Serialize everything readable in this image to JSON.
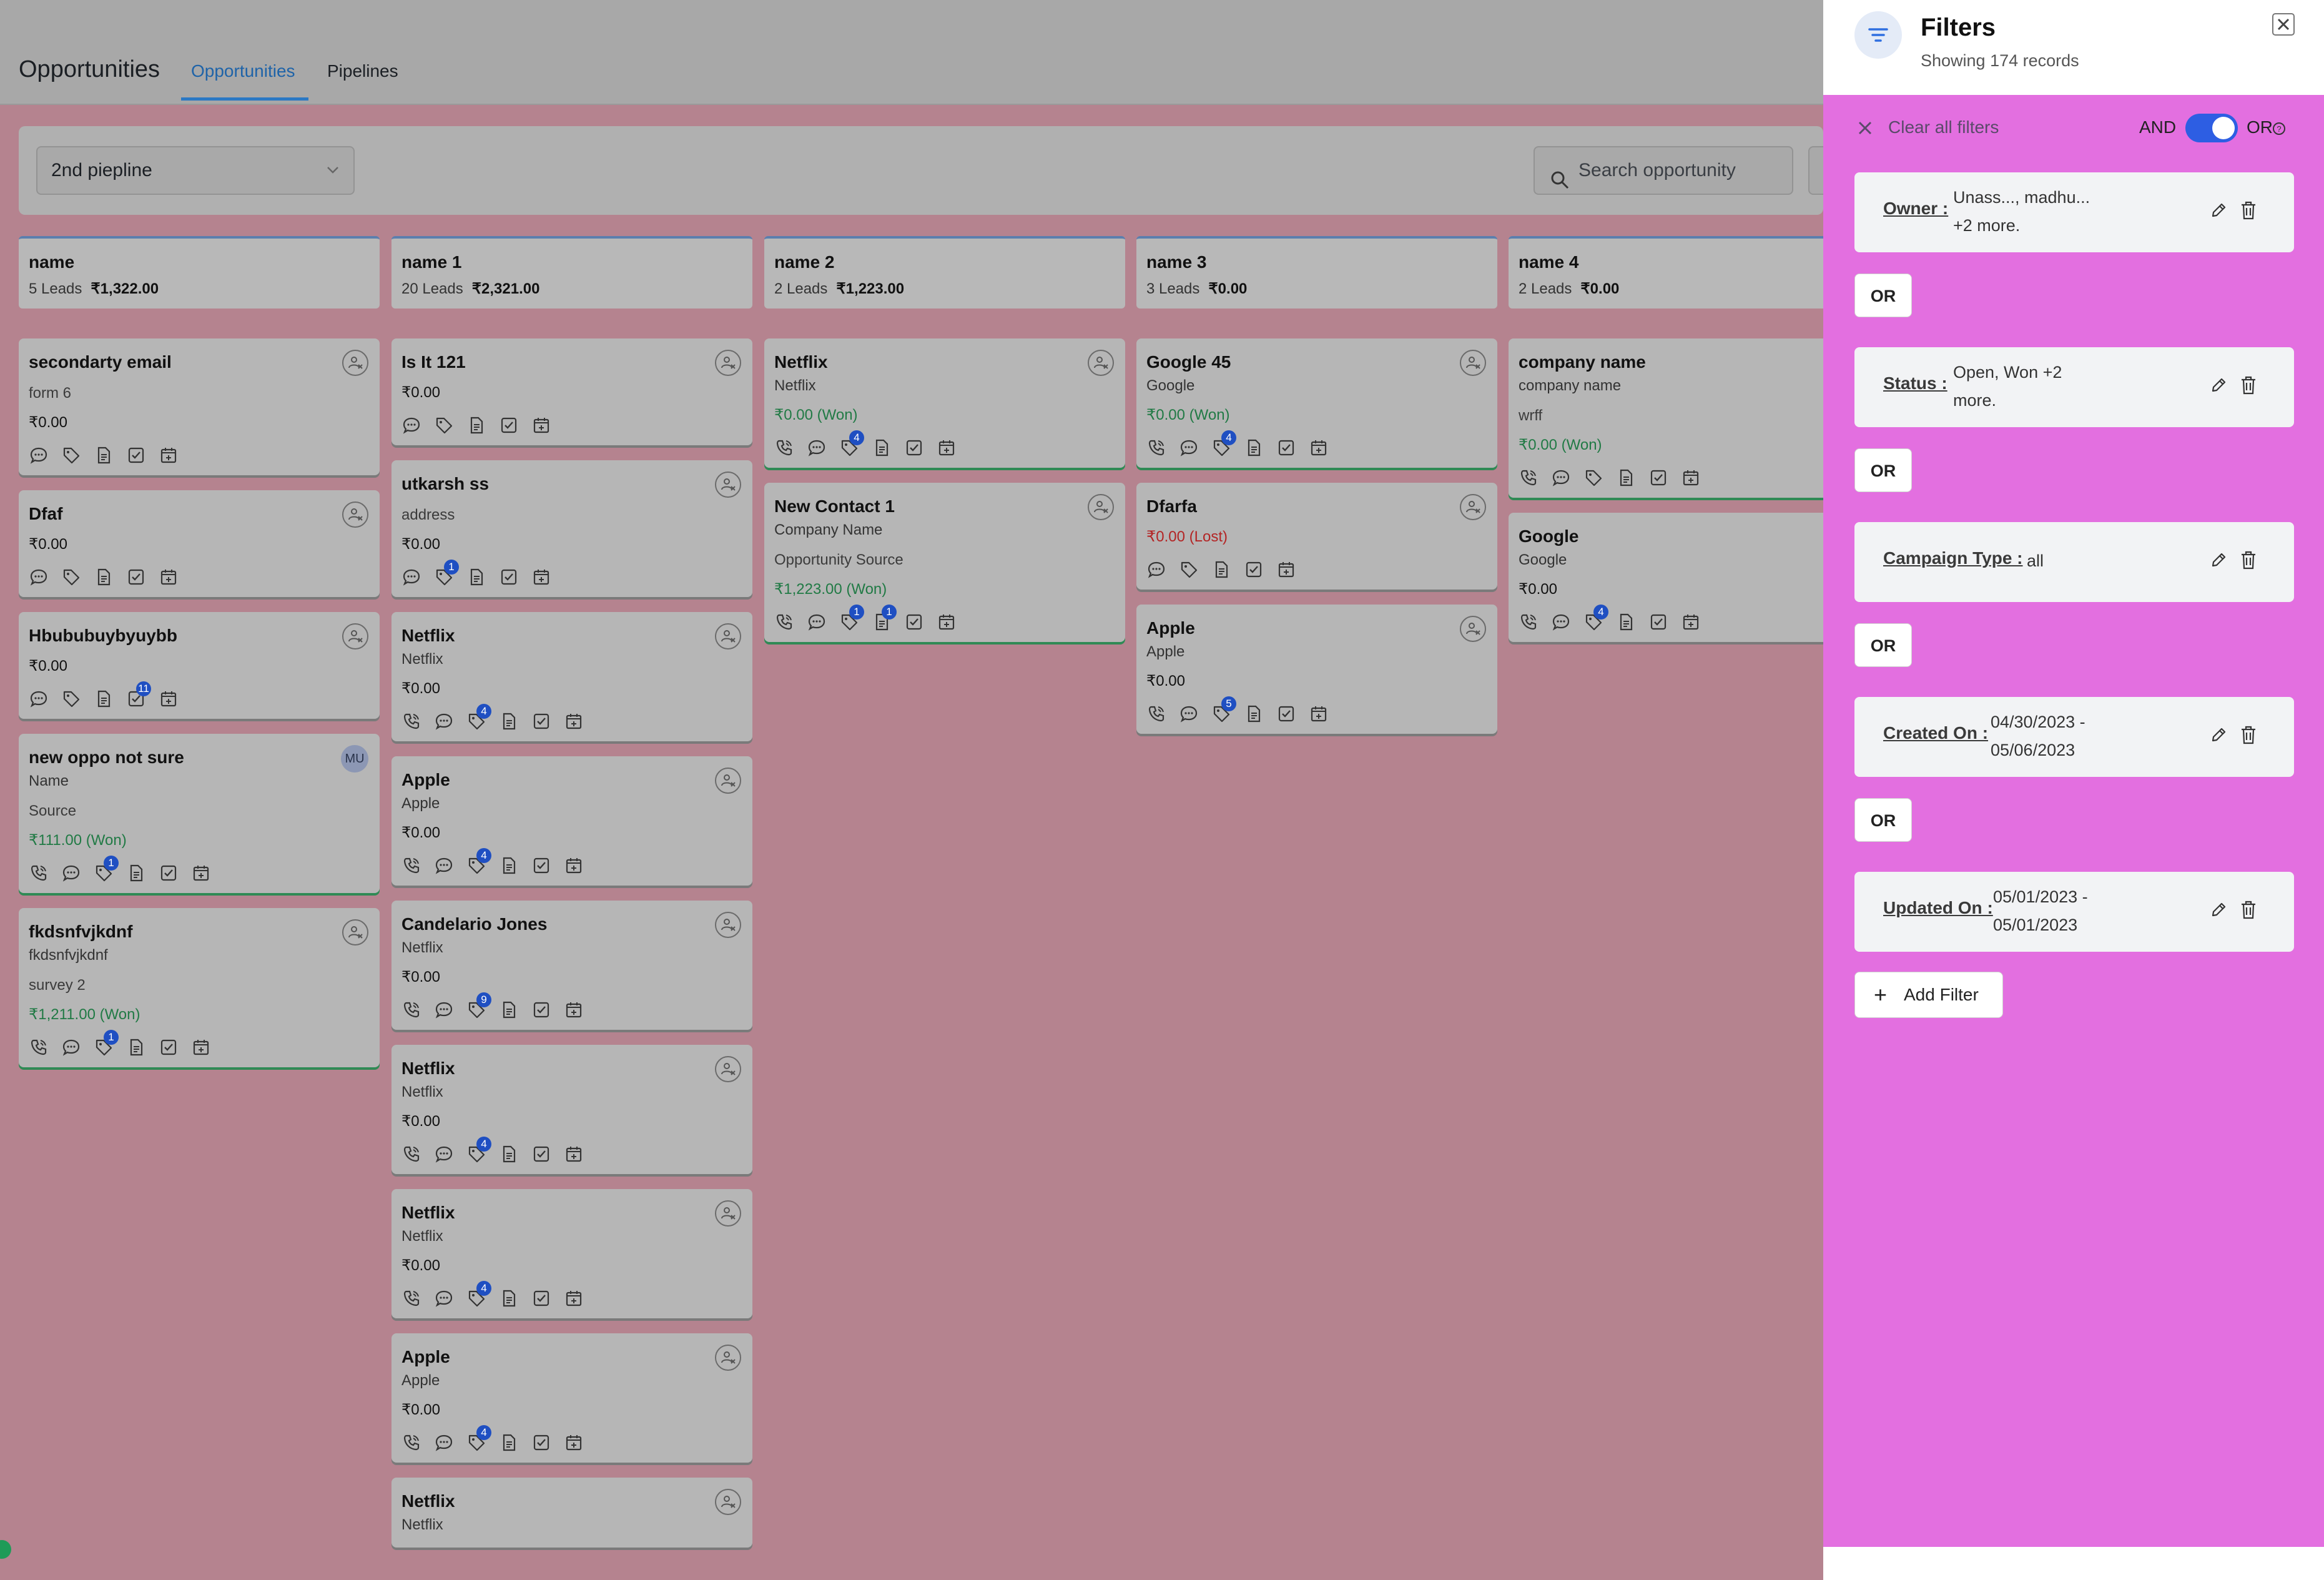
{
  "header": {
    "app_title": "Opportunities",
    "tabs": [
      {
        "label": "Opportunities",
        "active": true
      },
      {
        "label": "Pipelines",
        "active": false
      }
    ]
  },
  "toolbar": {
    "pipeline_select": "2nd piepline",
    "search_placeholder": "Search opportunity"
  },
  "columns": [
    {
      "name": "name",
      "leads": "5 Leads",
      "total": "₹1,322.00",
      "cards": [
        {
          "title": "secondarty email",
          "sub": "",
          "sub2": "form 6",
          "amount": "₹0.00",
          "status": "",
          "icons": [
            "chat",
            "tag",
            "doc",
            "check",
            "calendar"
          ],
          "badges": {},
          "owner": "assign"
        },
        {
          "title": "Dfaf",
          "sub": "",
          "sub2": "",
          "amount": "₹0.00",
          "status": "",
          "icons": [
            "chat",
            "tag",
            "doc",
            "check",
            "calendar"
          ],
          "badges": {},
          "owner": "assign"
        },
        {
          "title": "Hbububuybyuybb",
          "sub": "",
          "sub2": "",
          "amount": "₹0.00",
          "status": "",
          "icons": [
            "chat",
            "tag",
            "doc",
            "check",
            "calendar"
          ],
          "badges": {
            "3": "11"
          },
          "owner": "assign"
        },
        {
          "title": "new oppo not sure",
          "sub": "Name",
          "sub2": "Source",
          "amount": "₹111.00 (Won)",
          "status": "won",
          "icons": [
            "phone",
            "chat",
            "tag",
            "doc",
            "check",
            "calendar"
          ],
          "badges": {
            "2": "1"
          },
          "owner": "MU"
        },
        {
          "title": "fkdsnfvjkdnf",
          "sub": "fkdsnfvjkdnf",
          "sub2": "survey 2",
          "amount": "₹1,211.00 (Won)",
          "status": "won",
          "icons": [
            "phone",
            "chat",
            "tag",
            "doc",
            "check",
            "calendar"
          ],
          "badges": {
            "2": "1"
          },
          "owner": "assign"
        }
      ]
    },
    {
      "name": "name 1",
      "leads": "20 Leads",
      "total": "₹2,321.00",
      "cards": [
        {
          "title": "Is It 121",
          "sub": "",
          "sub2": "",
          "amount": "₹0.00",
          "status": "",
          "icons": [
            "chat",
            "tag",
            "doc",
            "check",
            "calendar"
          ],
          "badges": {},
          "owner": "assign"
        },
        {
          "title": "utkarsh ss",
          "sub": "",
          "sub2": "address",
          "amount": "₹0.00",
          "status": "",
          "icons": [
            "chat",
            "tag",
            "doc",
            "check",
            "calendar"
          ],
          "badges": {
            "1": "1"
          },
          "owner": "assign"
        },
        {
          "title": "Netflix",
          "sub": "Netflix",
          "sub2": "",
          "amount": "₹0.00",
          "status": "",
          "icons": [
            "phone",
            "chat",
            "tag",
            "doc",
            "check",
            "calendar"
          ],
          "badges": {
            "2": "4"
          },
          "owner": "assign"
        },
        {
          "title": "Apple",
          "sub": "Apple",
          "sub2": "",
          "amount": "₹0.00",
          "status": "",
          "icons": [
            "phone",
            "chat",
            "tag",
            "doc",
            "check",
            "calendar"
          ],
          "badges": {
            "2": "4"
          },
          "owner": "assign"
        },
        {
          "title": "Candelario Jones",
          "sub": "Netflix",
          "sub2": "",
          "amount": "₹0.00",
          "status": "",
          "icons": [
            "phone",
            "chat",
            "tag",
            "doc",
            "check",
            "calendar"
          ],
          "badges": {
            "2": "9"
          },
          "owner": "assign"
        },
        {
          "title": "Netflix",
          "sub": "Netflix",
          "sub2": "",
          "amount": "₹0.00",
          "status": "",
          "icons": [
            "phone",
            "chat",
            "tag",
            "doc",
            "check",
            "calendar"
          ],
          "badges": {
            "2": "4"
          },
          "owner": "assign"
        },
        {
          "title": "Netflix",
          "sub": "Netflix",
          "sub2": "",
          "amount": "₹0.00",
          "status": "",
          "icons": [
            "phone",
            "chat",
            "tag",
            "doc",
            "check",
            "calendar"
          ],
          "badges": {
            "2": "4"
          },
          "owner": "assign"
        },
        {
          "title": "Apple",
          "sub": "Apple",
          "sub2": "",
          "amount": "₹0.00",
          "status": "",
          "icons": [
            "phone",
            "chat",
            "tag",
            "doc",
            "check",
            "calendar"
          ],
          "badges": {
            "2": "4"
          },
          "owner": "assign"
        },
        {
          "title": "Netflix",
          "sub": "Netflix",
          "sub2": "",
          "amount": "",
          "status": "",
          "icons": [],
          "badges": {},
          "owner": "assign"
        }
      ]
    },
    {
      "name": "name 2",
      "leads": "2 Leads",
      "total": "₹1,223.00",
      "cards": [
        {
          "title": "Netflix",
          "sub": "Netflix",
          "sub2": "",
          "amount": "₹0.00 (Won)",
          "status": "won",
          "icons": [
            "phone",
            "chat",
            "tag",
            "doc",
            "check",
            "calendar"
          ],
          "badges": {
            "2": "4"
          },
          "owner": "assign"
        },
        {
          "title": "New Contact 1",
          "sub": "Company Name",
          "sub2": "Opportunity Source",
          "amount": "₹1,223.00 (Won)",
          "status": "won",
          "icons": [
            "phone",
            "chat",
            "tag",
            "doc",
            "check",
            "calendar"
          ],
          "badges": {
            "2": "1",
            "3": "1"
          },
          "owner": "assign"
        }
      ]
    },
    {
      "name": "name 3",
      "leads": "3 Leads",
      "total": "₹0.00",
      "cards": [
        {
          "title": "Google 45",
          "sub": "Google",
          "sub2": "",
          "amount": "₹0.00 (Won)",
          "status": "won",
          "icons": [
            "phone",
            "chat",
            "tag",
            "doc",
            "check",
            "calendar"
          ],
          "badges": {
            "2": "4"
          },
          "owner": "assign"
        },
        {
          "title": "Dfarfa",
          "sub": "",
          "sub2": "",
          "amount": "₹0.00 (Lost)",
          "status": "lost",
          "icons": [
            "chat",
            "tag",
            "doc",
            "check",
            "calendar"
          ],
          "badges": {},
          "owner": "assign"
        },
        {
          "title": "Apple",
          "sub": "Apple",
          "sub2": "",
          "amount": "₹0.00",
          "status": "",
          "icons": [
            "phone",
            "chat",
            "tag",
            "doc",
            "check",
            "calendar"
          ],
          "badges": {
            "2": "5"
          },
          "owner": "assign"
        }
      ]
    },
    {
      "name": "name 4",
      "leads": "2 Leads",
      "total": "₹0.00",
      "cards": [
        {
          "title": "company name",
          "sub": "company name",
          "sub2": "wrff",
          "amount": "₹0.00 (Won)",
          "status": "won",
          "icons": [
            "phone",
            "chat",
            "tag",
            "doc",
            "check",
            "calendar"
          ],
          "badges": {},
          "owner": "assign"
        },
        {
          "title": "Google",
          "sub": "Google",
          "sub2": "",
          "amount": "₹0.00",
          "status": "",
          "icons": [
            "phone",
            "chat",
            "tag",
            "doc",
            "check",
            "calendar"
          ],
          "badges": {
            "2": "4"
          },
          "owner": "assign"
        }
      ]
    }
  ],
  "filters_panel": {
    "title": "Filters",
    "subtitle": "Showing 174 records",
    "clear_all": "Clear all filters",
    "and_label": "AND",
    "or_label": "OR",
    "or_chip": "OR",
    "add_filter": "Add Filter",
    "filters": [
      {
        "key": "Owner :",
        "value_line1": "Unass..., madhu...",
        "value_line2": "+2 more."
      },
      {
        "key": "Status :",
        "value_line1": "Open, Won +2",
        "value_line2": "more."
      },
      {
        "key": "Campaign Type :",
        "value_line1": "all",
        "value_line2": ""
      },
      {
        "key": "Created On :",
        "value_line1": "04/30/2023 -",
        "value_line2": "05/06/2023"
      },
      {
        "key": "Updated On :",
        "value_line1": "05/01/2023 -",
        "value_line2": "05/01/2023"
      }
    ]
  }
}
